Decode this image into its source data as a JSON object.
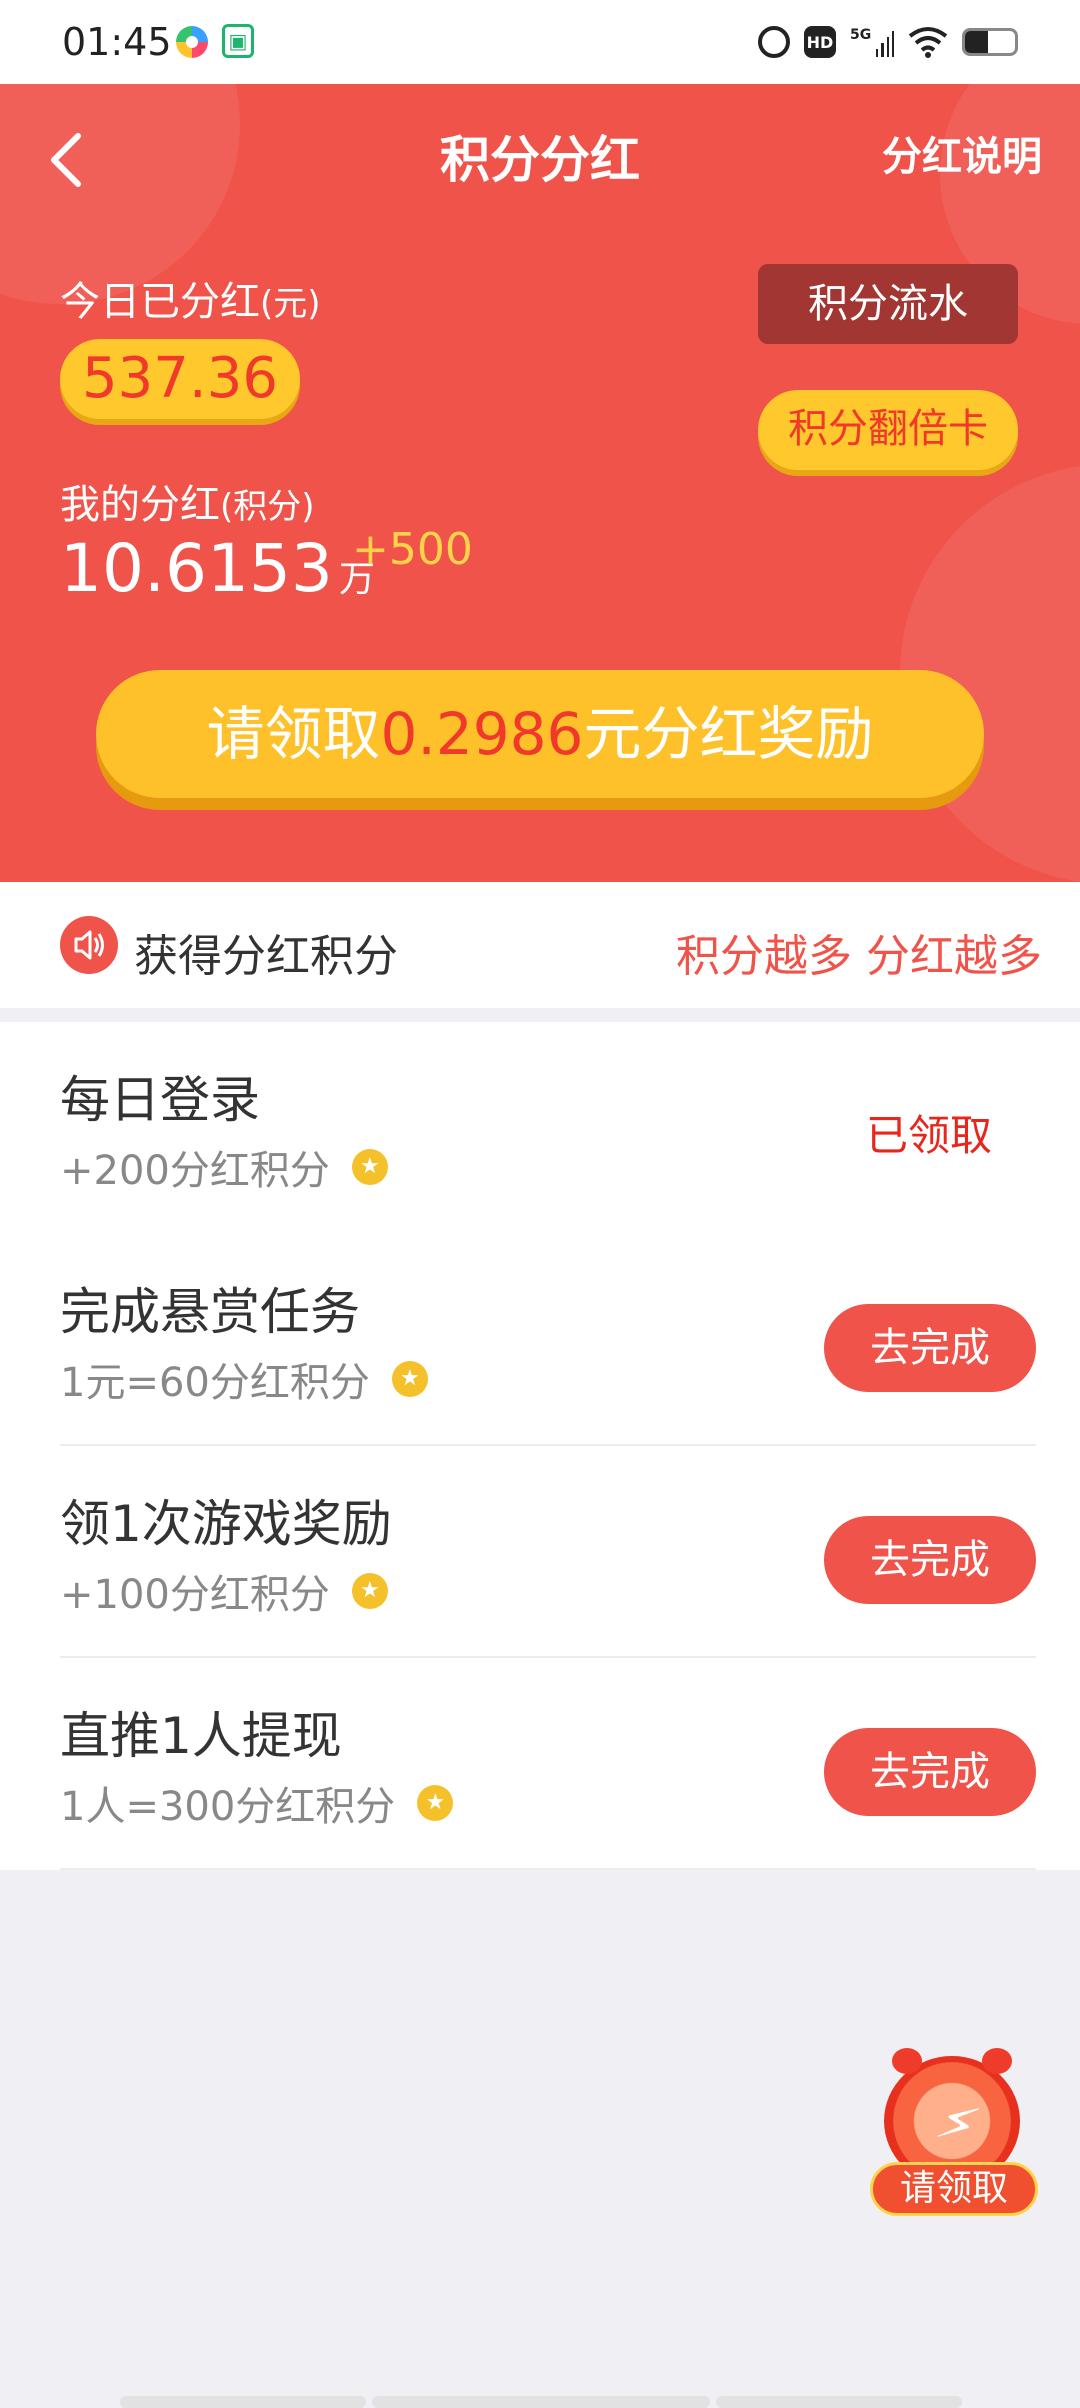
{
  "status_bar": {
    "time": "01:45",
    "icons": [
      "app-icon-colorful",
      "app-icon-green",
      "alarm-icon",
      "hd-icon",
      "signal-5g-icon",
      "wifi-icon",
      "battery-icon"
    ],
    "hd": "HD",
    "network": "5G",
    "battery_level": 0.45
  },
  "nav": {
    "back_icon": "chevron-left-icon",
    "title": "积分分红",
    "right_link": "分红说明"
  },
  "summary": {
    "today_label": "今日已分红",
    "today_unit": "(元)",
    "today_value": "537.36",
    "flow_button": "积分流水",
    "double_card_button": "积分翻倍卡",
    "my_label": "我的分红",
    "my_unit": "(积分)",
    "my_value": "10.6153",
    "my_value_unit": "万",
    "my_increment": "+500"
  },
  "claim": {
    "prefix": "请领取",
    "amount": "0.2986",
    "suffix": "元分红奖励"
  },
  "section": {
    "icon": "speaker-icon",
    "title": "获得分红积分",
    "slogan": "积分越多 分红越多"
  },
  "tasks": [
    {
      "title": "每日登录",
      "reward": "+200分红积分",
      "action": "已领取",
      "done": true
    },
    {
      "title": "完成悬赏任务",
      "reward": "1元=60分红积分",
      "action": "去完成",
      "done": false
    },
    {
      "title": "领1次游戏奖励",
      "reward": "+100分红积分",
      "action": "去完成",
      "done": false
    },
    {
      "title": "直推1人提现",
      "reward": "1人=300分红积分",
      "action": "去完成",
      "done": false
    }
  ],
  "float_widget": {
    "icon": "alarm-clock-icon",
    "label": "请领取"
  },
  "colors": {
    "primary_red": "#f0534a",
    "gold": "#ffc12a",
    "done_red": "#e8261c"
  }
}
